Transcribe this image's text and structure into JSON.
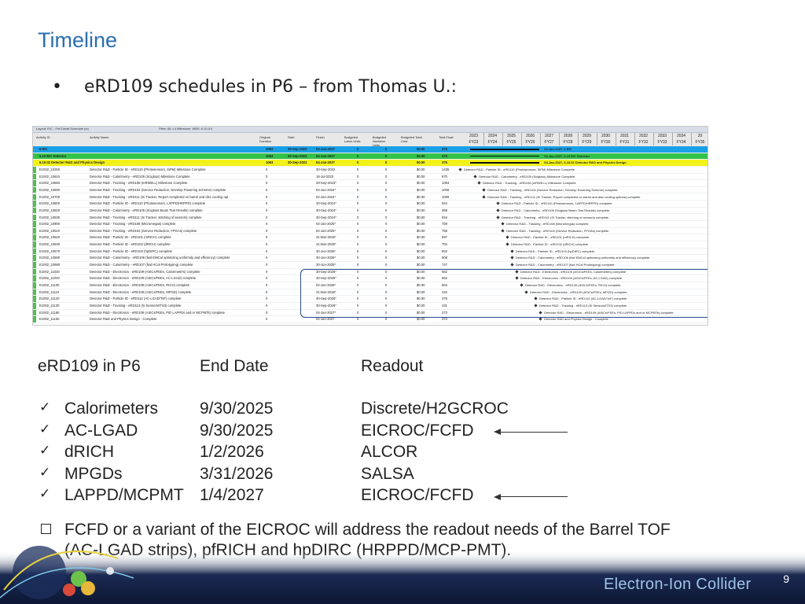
{
  "title": "Timeline",
  "bullet": "eRD109 schedules in P6 – from Thomas U.:",
  "schedule": {
    "layout_label": "Layout: EIC - Full Detail Schedule (w)",
    "filter_label": "Filter: All, L4 Milestone, WBS: 6.10.XX",
    "columns": [
      "Activity ID",
      "Activity Name",
      "Original Duration",
      "Start",
      "Finish",
      "Budgeted Labor Units",
      "Budgeted Nonlabor Units",
      "Budgeted Total Cost",
      "Total Float"
    ],
    "years": [
      "2023",
      "2024",
      "2025",
      "2026",
      "2027",
      "2028",
      "2029",
      "2030",
      "2031",
      "2032",
      "2033",
      "2034",
      "20"
    ],
    "fiscal_years": [
      "FY23",
      "FY24",
      "FY25",
      "FY26",
      "FY27",
      "FY28",
      "FY29",
      "FY30",
      "FY31",
      "FY32",
      "FY33",
      "FY34",
      "FY35"
    ],
    "rows": [
      {
        "id": "6 EIC",
        "name": "",
        "dur": "1063",
        "start": "30-Sep-2022",
        "finish": "04-Jan-2027",
        "lab": "0",
        "nonlab": "0",
        "cost": "$0.00",
        "float": "375",
        "gantt": "04-Jan-2027, 6 EIC",
        "style": "blue"
      },
      {
        "id": "6.10 EIC Detector",
        "name": "",
        "dur": "1063",
        "start": "30-Sep-2022",
        "finish": "04-Jan-2027",
        "lab": "0",
        "nonlab": "0",
        "cost": "$0.00",
        "float": "375",
        "gantt": "04-Jan-2027, 6.10 EIC Detector",
        "style": "green"
      },
      {
        "id": "6.10.02 Detector R&D and Physics Design",
        "name": "",
        "dur": "1063",
        "start": "30-Sep-2022",
        "finish": "04-Jan-2027",
        "lab": "0",
        "nonlab": "0",
        "cost": "$0.00",
        "float": "375",
        "gantt": "04-Jan-2027, 6.10.02 Detector R&D and Physics Design",
        "style": "yellow"
      },
      {
        "id": "E1002_10250",
        "name": "Detector R&D - Particle ID - eRD110 (Photosensors, SiPM) Milestone Complete",
        "dur": "0",
        "start": "",
        "finish": "30-Sep-2022",
        "lab": "0",
        "nonlab": "0",
        "cost": "$0.00",
        "float": "1435",
        "gantt": "Detector R&D - Particle ID - eRD110 (Photosensors, SiPM) Milestone Complete",
        "style": ""
      },
      {
        "id": "E1002_10610",
        "name": "Detector R&D - Calorimetry - eRD105 (Scigloss) Milestone Complete",
        "dur": "0",
        "start": "",
        "finish": "18-Jul-2023",
        "lab": "0",
        "nonlab": "0",
        "cost": "$0.00",
        "float": "670",
        "gantt": "Detector R&D - Calorimetry - eRD105 (Scigloss) Milestone Complete",
        "style": ""
      },
      {
        "id": "E1002_10660",
        "name": "Detector R&D - Tracking - eRD108 (mRWELL) Milestone Complete",
        "dur": "0",
        "start": "",
        "finish": "29-Sep-2023*",
        "lab": "0",
        "nonlab": "0",
        "cost": "$0.00",
        "float": "1063",
        "gantt": "Detector R&D - Tracking - eRD108 (mRWELL) Milestone Complete",
        "style": ""
      },
      {
        "id": "E1002_10690",
        "name": "Detector R&D - Tracking - eRD104 (Service Reduction, Develop Powering Scheme) complete",
        "dur": "0",
        "start": "",
        "finish": "02-Jan-2024*",
        "lab": "0",
        "nonlab": "0",
        "cost": "$0.00",
        "float": "1006",
        "gantt": "Detector R&D - Tracking - eRD104 (Service Reduction, Develop Powering Scheme) complete",
        "style": ""
      },
      {
        "id": "E1002_10700",
        "name": "Detector R&D - Tracking - eRD111 (Si Tracker, Report completed on barrel and disc cooling opt",
        "dur": "0",
        "start": "",
        "finish": "02-Jan-2024*",
        "lab": "0",
        "nonlab": "0",
        "cost": "$0.00",
        "float": "1006",
        "gantt": "Detector R&D - Tracking - eRD111 (Si Tracker, Report completed on barrel and disc cooling options) complete",
        "style": ""
      },
      {
        "id": "E1002_10800",
        "name": "Detector R&D - Particle ID - eRD110 (Photosensors, LAPPD/HRPPD) complete",
        "dur": "0",
        "start": "",
        "finish": "30-Sep-2024*",
        "lab": "0",
        "nonlab": "0",
        "cost": "$0.00",
        "float": "924",
        "gantt": "Detector R&D - Particle ID - eRD110 (Photosensors, LAPPD/HRPPD) complete",
        "style": ""
      },
      {
        "id": "E1002_10820",
        "name": "Detector R&D - Calorimetry - eRD105 (Scigloss Beam Test Results) complete",
        "dur": "0",
        "start": "",
        "finish": "30-Sep-2024*",
        "lab": "0",
        "nonlab": "0",
        "cost": "$0.00",
        "float": "369",
        "gantt": "Detector R&D - Calorimetry - eRD105 (Scigloss Beam Test Results) complete",
        "style": ""
      },
      {
        "id": "E1002_10830",
        "name": "Detector R&D - Tracking - eRD111 (Si Tracker, stitching of sensors) complete",
        "dur": "0",
        "start": "",
        "finish": "30-Sep-2024*",
        "lab": "0",
        "nonlab": "0",
        "cost": "$0.00",
        "float": "816",
        "gantt": "Detector R&D - Tracking - eRD111 (Si Tracker, stitching of sensors) complete",
        "style": ""
      },
      {
        "id": "E1002_10900",
        "name": "Detector R&D - Tracking - eRD108 (Micromegas) complete",
        "dur": "0",
        "start": "",
        "finish": "02-Jan-2025*",
        "lab": "0",
        "nonlab": "0",
        "cost": "$0.00",
        "float": "759",
        "gantt": "Detector R&D - Tracking - eRD108 (Micromegas) complete",
        "style": ""
      },
      {
        "id": "E1002_10510",
        "name": "Detector R&D - Tracking - eRD104 (Service Reduction, FPGAs) complete",
        "dur": "0",
        "start": "",
        "finish": "02-Jan-2025*",
        "lab": "0",
        "nonlab": "0",
        "cost": "$0.00",
        "float": "759",
        "gantt": "Detector R&D - Tracking - eRD104 (Service Reduction, FPGAs) complete",
        "style": ""
      },
      {
        "id": "E1002_10520",
        "name": "Detector R&D - Particle ID - eRD101 (mRICH) complete",
        "dur": "0",
        "start": "",
        "finish": "31-Mar-2025*",
        "lab": "0",
        "nonlab": "0",
        "cost": "$0.00",
        "float": "697",
        "gantt": "Detector R&D - Particle ID - eRD101 (mRICH) complete",
        "style": ""
      },
      {
        "id": "E1002_10530",
        "name": "Detector R&D - Particle ID - eRD102 (dRICH) complete",
        "dur": "0",
        "start": "",
        "finish": "31-Mar-2025*",
        "lab": "0",
        "nonlab": "0",
        "cost": "$0.00",
        "float": "704",
        "gantt": "Detector R&D - Particle ID - eRD102 (dRICH) complete",
        "style": ""
      },
      {
        "id": "E1002_10570",
        "name": "Detector R&D - Particle ID - eRD103 (hpDIRC) complete",
        "dur": "0",
        "start": "",
        "finish": "30-Jun-2025*",
        "lab": "0",
        "nonlab": "0",
        "cost": "$0.00",
        "float": "602",
        "gantt": "Detector R&D - Particle ID - eRD103 (hpDIRC) complete",
        "style": ""
      },
      {
        "id": "E1002_10580",
        "name": "Detector R&D - Calorimetry - eRD106 (fwd EMCal optimizing uniformity and efficiency) complete",
        "dur": "0",
        "start": "",
        "finish": "30-Jun-2025*",
        "lab": "0",
        "nonlab": "0",
        "cost": "$0.00",
        "float": "508",
        "gantt": "Detector R&D - Calorimetry - eRD106 (fwd EMCal optimizing uniformity and efficiency) complete",
        "style": ""
      },
      {
        "id": "E1002_10990",
        "name": "Detector R&D - Calorimetry - eRD107 (fwd HCal Prototyping) complete",
        "dur": "0",
        "start": "",
        "finish": "30-Jun-2025*",
        "lab": "0",
        "nonlab": "0",
        "cost": "$0.00",
        "float": "747",
        "gantt": "Detector R&D - Calorimetry - eRD107 (fwd HCal Prototyping) complete",
        "style": ""
      },
      {
        "id": "E1002_11030",
        "name": "Detector R&D - Electronics - eRD109 (ASICs/FEEs, Calorimeters) complete",
        "dur": "0",
        "start": "",
        "finish": "30-Sep-2025*",
        "lab": "0",
        "nonlab": "0",
        "cost": "$0.00",
        "float": "562",
        "gantt": "Detector R&D - Electronics - eRD109 (ASICs/FEEs, Calorimeters) complete",
        "style": "hl"
      },
      {
        "id": "E1002_11040",
        "name": "Detector R&D - Electronics - eRD109 (ASICs/FEEs, AC-LGAD) complete",
        "dur": "0",
        "start": "",
        "finish": "30-Sep-2025*",
        "lab": "0",
        "nonlab": "0",
        "cost": "$0.00",
        "float": "562",
        "gantt": "Detector R&D - Electronics - eRD109 (ASICs/FEEs, AC-LGAD) complete",
        "style": "hl"
      },
      {
        "id": "E1002_11100",
        "name": "Detector R&D - Electronics - eRD109 (ASICs/FEEs, RICH) complete",
        "dur": "0",
        "start": "",
        "finish": "02-Jan-2026*",
        "lab": "0",
        "nonlab": "0",
        "cost": "$0.00",
        "float": "504",
        "gantt": "Detector R&D - Electronics - eRD109 (ASICs/FEEs, RICH) complete",
        "style": "hl"
      },
      {
        "id": "E1002_11110",
        "name": "Detector R&D - Electronics - eRD109 (ASICs/FEEs, MPGD) complete",
        "dur": "0",
        "start": "",
        "finish": "31-Mar-2026*",
        "lab": "0",
        "nonlab": "0",
        "cost": "$0.00",
        "float": "442",
        "gantt": "Detector R&D - Electronics - eRD109 (ASICs/FEEs, MPGD) complete",
        "style": "hl"
      },
      {
        "id": "E1002_11120",
        "name": "Detector R&D - Particle ID - eRD112 (AC-LGAD/ToF) complete",
        "dur": "0",
        "start": "",
        "finish": "30-Sep-2026*",
        "lab": "0",
        "nonlab": "0",
        "cost": "$0.00",
        "float": "375",
        "gantt": "Detector R&D - Particle ID - eRD112 (AC-LGAD/ToF) complete",
        "style": ""
      },
      {
        "id": "E1002_11130",
        "name": "Detector R&D - Tracking - eRD113 (Si Sensors/ITS3) complete",
        "dur": "0",
        "start": "",
        "finish": "30-Sep-2026*",
        "lab": "0",
        "nonlab": "0",
        "cost": "$0.00",
        "float": "431",
        "gantt": "Detector R&D - Tracking - eRD113 (Si Sensors/ITS3) complete",
        "style": ""
      },
      {
        "id": "E1002_11180",
        "name": "Detector R&D - Electronics - eRD109 (ASICs/FEEs, PID LAPPDs and or MCPMTs) complete",
        "dur": "0",
        "start": "",
        "finish": "04-Jan-2027*",
        "lab": "0",
        "nonlab": "0",
        "cost": "$0.00",
        "float": "373",
        "gantt": "Detector R&D - Electronics - eRD109 (ASICs/FEEs, PID LAPPDs and or MCPMTs) complete",
        "style": "hl"
      },
      {
        "id": "E1002_11150",
        "name": "Detector R&D and Physics Design - Complete",
        "dur": "0",
        "start": "",
        "finish": "04-Jan-2027",
        "lab": "0",
        "nonlab": "0",
        "cost": "$0.00",
        "float": "373",
        "gantt": "Detector R&D and Physics Design - Complete",
        "style": ""
      }
    ]
  },
  "table": {
    "headers": [
      "eRD109 in P6",
      "End Date",
      "Readout"
    ],
    "rows": [
      {
        "item": "Calorimeters",
        "date": "9/30/2025",
        "readout": "Discrete/H2GCROC",
        "arrow": false
      },
      {
        "item": "AC-LGAD",
        "date": "9/30/2025",
        "readout": "EICROC/FCFD",
        "arrow": true
      },
      {
        "item": "dRICH",
        "date": "1/2/2026",
        "readout": "ALCOR",
        "arrow": false
      },
      {
        "item": "MPGDs",
        "date": "3/31/2026",
        "readout": "SALSA",
        "arrow": false
      },
      {
        "item": "LAPPD/MCPMT",
        "date": "1/4/2027",
        "readout": "EICROC/FCFD",
        "arrow": true
      }
    ]
  },
  "note": {
    "line1": "FCFD or a variant of the EICROC will address the readout needs of the Barrel TOF",
    "line2": "(AC-LGAD strips), pfRICH and hpDIRC (HRPPD/MCP-PMT)."
  },
  "footer": {
    "logo_text": "Electron-Ion Collider",
    "page_number": "9"
  },
  "colors": {
    "title": "#2a6fb0",
    "oval": "#2a4d8f",
    "row_blue": "#1aa0e6",
    "row_green": "#33c34a",
    "row_yellow": "#f2f21a",
    "row_left_green": "#4ec04e"
  }
}
